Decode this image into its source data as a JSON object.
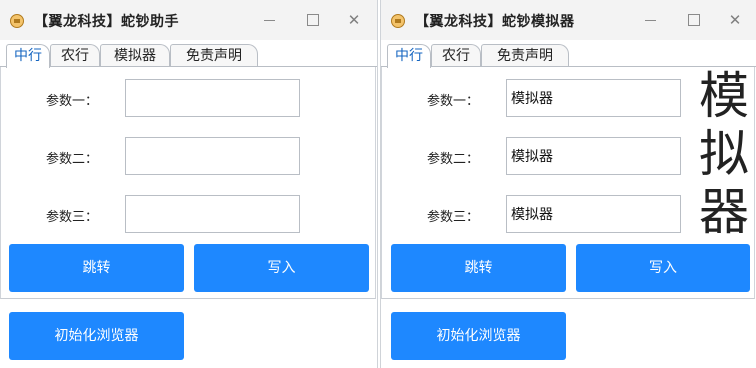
{
  "windows": [
    {
      "title": "【翼龙科技】蛇钞助手",
      "tabs": [
        "中行",
        "农行",
        "模拟器",
        "免责声明"
      ],
      "active_tab": 0,
      "fields": [
        {
          "label": "参数一：",
          "value": ""
        },
        {
          "label": "参数二：",
          "value": ""
        },
        {
          "label": "参数三：",
          "value": ""
        }
      ],
      "buttons": {
        "jump": "跳转",
        "write": "写入",
        "init": "初始化浏览器"
      }
    },
    {
      "title": "【翼龙科技】蛇钞模拟器",
      "tabs": [
        "中行",
        "农行",
        "免责声明"
      ],
      "active_tab": 0,
      "fields": [
        {
          "label": "参数一：",
          "value": "模拟器"
        },
        {
          "label": "参数二：",
          "value": "模拟器"
        },
        {
          "label": "参数三：",
          "value": "模拟器"
        }
      ],
      "buttons": {
        "jump": "跳转",
        "write": "写入",
        "init": "初始化浏览器"
      },
      "side_text": [
        "模",
        "拟",
        "器"
      ]
    }
  ],
  "colors": {
    "accent": "#1e88ff",
    "active_tab_text": "#1565c0"
  },
  "icons": {
    "app": "coin-app-icon",
    "min": "minimize-icon",
    "max": "maximize-icon",
    "close": "close-icon"
  }
}
